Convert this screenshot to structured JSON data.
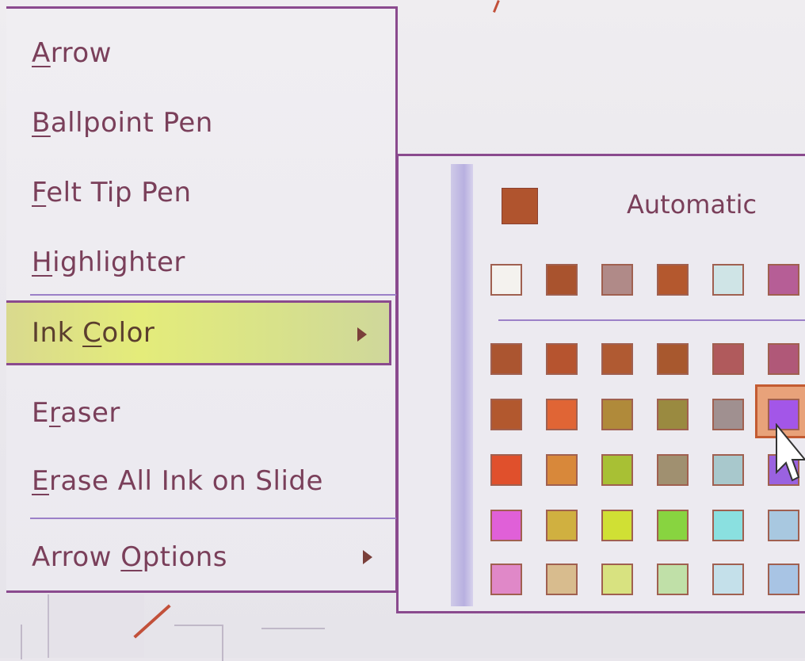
{
  "menu": {
    "items": [
      {
        "pre": "",
        "key": "A",
        "post": "rrow"
      },
      {
        "pre": "",
        "key": "B",
        "post": "allpoint Pen"
      },
      {
        "pre": "",
        "key": "F",
        "post": "elt Tip Pen"
      },
      {
        "pre": "",
        "key": "H",
        "post": "ighlighter"
      },
      {
        "pre": "Ink ",
        "key": "C",
        "post": "olor"
      },
      {
        "pre": "E",
        "key": "r",
        "post": "aser"
      },
      {
        "pre": "",
        "key": "E",
        "post": "rase All Ink on Slide"
      },
      {
        "pre": "Arrow ",
        "key": "O",
        "post": "ptions"
      }
    ]
  },
  "ink_color_submenu": {
    "automatic_label": "Automatic",
    "automatic_color": "#b0542e",
    "recent_colors": [
      "#f4f2ee",
      "#a9532e",
      "#b08a88",
      "#b4582e",
      "#cfe4e6",
      "#b65e96"
    ],
    "palette": [
      [
        "#ab5530",
        "#b6542f",
        "#b05a32",
        "#a8582e",
        "#b05a5c",
        "#b05878"
      ],
      [
        "#b2582e",
        "#e06535",
        "#b08a3a",
        "#9a8a40",
        "#a09090",
        "#a356e8"
      ],
      [
        "#e0502c",
        "#d8883a",
        "#a8c034",
        "#a09070",
        "#a8c8cc",
        "#9a62e0"
      ],
      [
        "#e060d8",
        "#d0b040",
        "#d0e034",
        "#88d440",
        "#8ae0e0",
        "#a8c8e0"
      ],
      [
        "#e088c8",
        "#d8bc8e",
        "#d8e280",
        "#c0e0a8",
        "#c4e0ea",
        "#a8c4e4"
      ]
    ],
    "hovered_color": "#a356e8"
  },
  "colors": {
    "menu_border": "#8a4a8e",
    "menu_text": "#7a3f5a",
    "highlight": "#e4ec7a",
    "separator": "#9b80c8"
  }
}
